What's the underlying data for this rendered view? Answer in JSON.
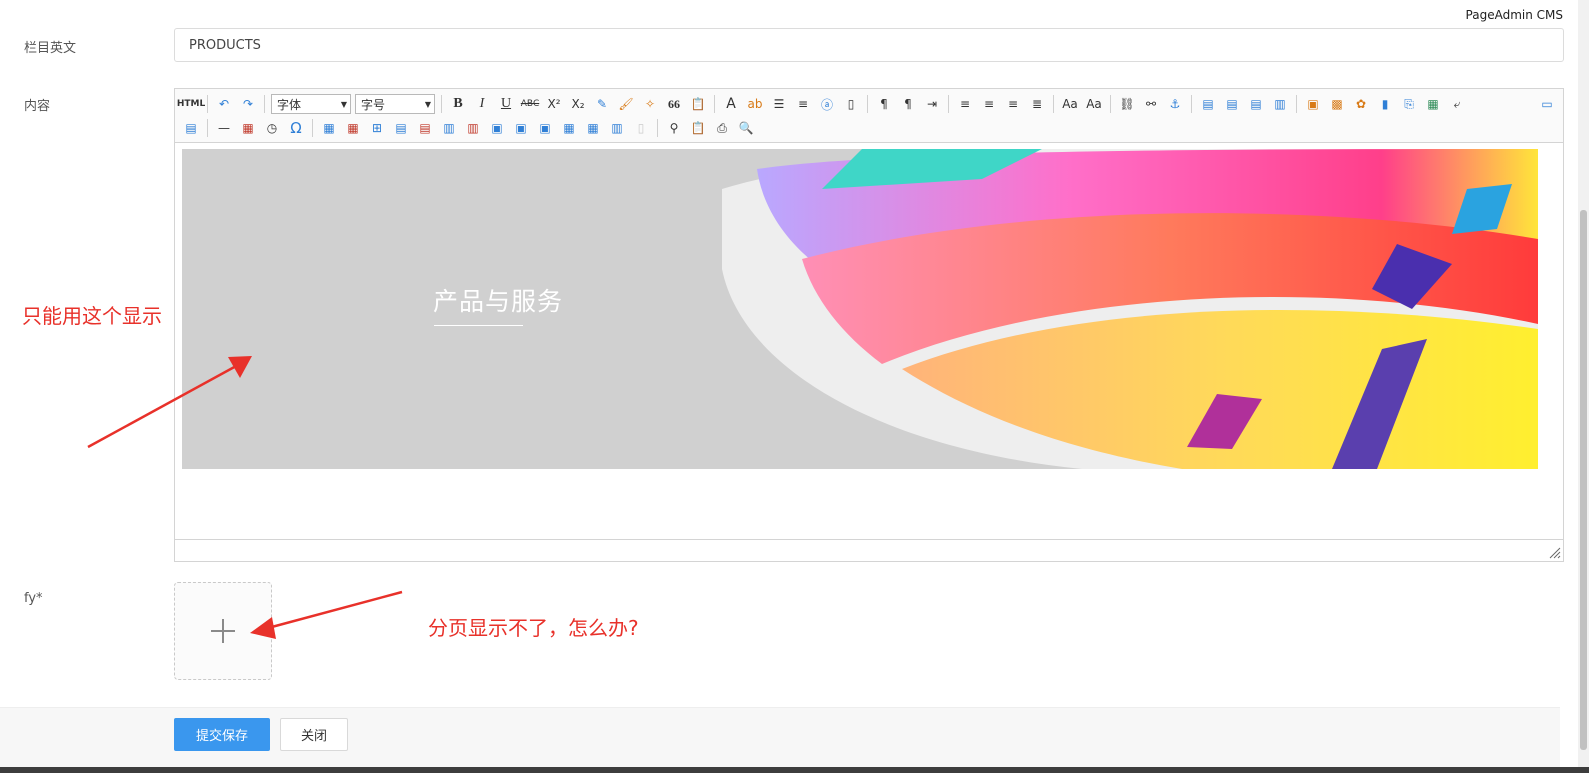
{
  "brand": "PageAdmin CMS",
  "fields": {
    "english_name": {
      "label": "栏目英文",
      "value": "PRODUCTS"
    },
    "content": {
      "label": "内容"
    },
    "fy": {
      "label": "fy*"
    }
  },
  "editor": {
    "toolbar": {
      "font_family": "字体",
      "font_size": "字号",
      "html_label": "HTML",
      "bold_label": "B",
      "italic_label": "I",
      "underline_label": "U",
      "strike_label": "ABC",
      "quote_label": "66",
      "font_color_label": "A",
      "omega_label": "Ω"
    },
    "banner": {
      "title": "产品与服务"
    }
  },
  "annotations": {
    "left_note": "只能用这个显示",
    "right_note": "分页显示不了，怎么办?"
  },
  "buttons": {
    "submit": "提交保存",
    "close": "关闭"
  },
  "colors": {
    "primary": "#3a97ee",
    "annotation": "#e8312a",
    "banner_bg": "#d0d0d0"
  }
}
